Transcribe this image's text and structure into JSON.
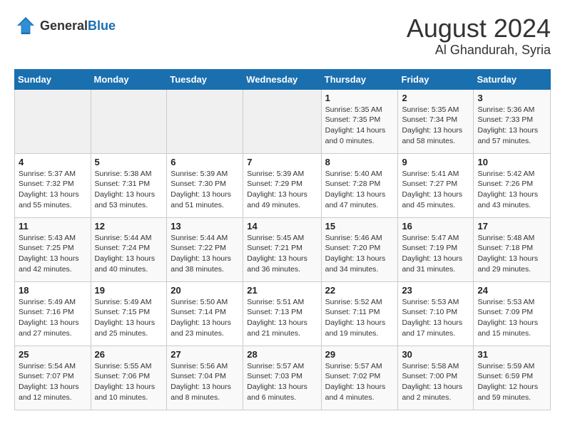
{
  "header": {
    "logo_general": "General",
    "logo_blue": "Blue",
    "title": "August 2024",
    "subtitle": "Al Ghandurah, Syria"
  },
  "calendar": {
    "days_of_week": [
      "Sunday",
      "Monday",
      "Tuesday",
      "Wednesday",
      "Thursday",
      "Friday",
      "Saturday"
    ],
    "weeks": [
      [
        {
          "day": "",
          "detail": ""
        },
        {
          "day": "",
          "detail": ""
        },
        {
          "day": "",
          "detail": ""
        },
        {
          "day": "",
          "detail": ""
        },
        {
          "day": "1",
          "detail": "Sunrise: 5:35 AM\nSunset: 7:35 PM\nDaylight: 14 hours\nand 0 minutes."
        },
        {
          "day": "2",
          "detail": "Sunrise: 5:35 AM\nSunset: 7:34 PM\nDaylight: 13 hours\nand 58 minutes."
        },
        {
          "day": "3",
          "detail": "Sunrise: 5:36 AM\nSunset: 7:33 PM\nDaylight: 13 hours\nand 57 minutes."
        }
      ],
      [
        {
          "day": "4",
          "detail": "Sunrise: 5:37 AM\nSunset: 7:32 PM\nDaylight: 13 hours\nand 55 minutes."
        },
        {
          "day": "5",
          "detail": "Sunrise: 5:38 AM\nSunset: 7:31 PM\nDaylight: 13 hours\nand 53 minutes."
        },
        {
          "day": "6",
          "detail": "Sunrise: 5:39 AM\nSunset: 7:30 PM\nDaylight: 13 hours\nand 51 minutes."
        },
        {
          "day": "7",
          "detail": "Sunrise: 5:39 AM\nSunset: 7:29 PM\nDaylight: 13 hours\nand 49 minutes."
        },
        {
          "day": "8",
          "detail": "Sunrise: 5:40 AM\nSunset: 7:28 PM\nDaylight: 13 hours\nand 47 minutes."
        },
        {
          "day": "9",
          "detail": "Sunrise: 5:41 AM\nSunset: 7:27 PM\nDaylight: 13 hours\nand 45 minutes."
        },
        {
          "day": "10",
          "detail": "Sunrise: 5:42 AM\nSunset: 7:26 PM\nDaylight: 13 hours\nand 43 minutes."
        }
      ],
      [
        {
          "day": "11",
          "detail": "Sunrise: 5:43 AM\nSunset: 7:25 PM\nDaylight: 13 hours\nand 42 minutes."
        },
        {
          "day": "12",
          "detail": "Sunrise: 5:44 AM\nSunset: 7:24 PM\nDaylight: 13 hours\nand 40 minutes."
        },
        {
          "day": "13",
          "detail": "Sunrise: 5:44 AM\nSunset: 7:22 PM\nDaylight: 13 hours\nand 38 minutes."
        },
        {
          "day": "14",
          "detail": "Sunrise: 5:45 AM\nSunset: 7:21 PM\nDaylight: 13 hours\nand 36 minutes."
        },
        {
          "day": "15",
          "detail": "Sunrise: 5:46 AM\nSunset: 7:20 PM\nDaylight: 13 hours\nand 34 minutes."
        },
        {
          "day": "16",
          "detail": "Sunrise: 5:47 AM\nSunset: 7:19 PM\nDaylight: 13 hours\nand 31 minutes."
        },
        {
          "day": "17",
          "detail": "Sunrise: 5:48 AM\nSunset: 7:18 PM\nDaylight: 13 hours\nand 29 minutes."
        }
      ],
      [
        {
          "day": "18",
          "detail": "Sunrise: 5:49 AM\nSunset: 7:16 PM\nDaylight: 13 hours\nand 27 minutes."
        },
        {
          "day": "19",
          "detail": "Sunrise: 5:49 AM\nSunset: 7:15 PM\nDaylight: 13 hours\nand 25 minutes."
        },
        {
          "day": "20",
          "detail": "Sunrise: 5:50 AM\nSunset: 7:14 PM\nDaylight: 13 hours\nand 23 minutes."
        },
        {
          "day": "21",
          "detail": "Sunrise: 5:51 AM\nSunset: 7:13 PM\nDaylight: 13 hours\nand 21 minutes."
        },
        {
          "day": "22",
          "detail": "Sunrise: 5:52 AM\nSunset: 7:11 PM\nDaylight: 13 hours\nand 19 minutes."
        },
        {
          "day": "23",
          "detail": "Sunrise: 5:53 AM\nSunset: 7:10 PM\nDaylight: 13 hours\nand 17 minutes."
        },
        {
          "day": "24",
          "detail": "Sunrise: 5:53 AM\nSunset: 7:09 PM\nDaylight: 13 hours\nand 15 minutes."
        }
      ],
      [
        {
          "day": "25",
          "detail": "Sunrise: 5:54 AM\nSunset: 7:07 PM\nDaylight: 13 hours\nand 12 minutes."
        },
        {
          "day": "26",
          "detail": "Sunrise: 5:55 AM\nSunset: 7:06 PM\nDaylight: 13 hours\nand 10 minutes."
        },
        {
          "day": "27",
          "detail": "Sunrise: 5:56 AM\nSunset: 7:04 PM\nDaylight: 13 hours\nand 8 minutes."
        },
        {
          "day": "28",
          "detail": "Sunrise: 5:57 AM\nSunset: 7:03 PM\nDaylight: 13 hours\nand 6 minutes."
        },
        {
          "day": "29",
          "detail": "Sunrise: 5:57 AM\nSunset: 7:02 PM\nDaylight: 13 hours\nand 4 minutes."
        },
        {
          "day": "30",
          "detail": "Sunrise: 5:58 AM\nSunset: 7:00 PM\nDaylight: 13 hours\nand 2 minutes."
        },
        {
          "day": "31",
          "detail": "Sunrise: 5:59 AM\nSunset: 6:59 PM\nDaylight: 12 hours\nand 59 minutes."
        }
      ]
    ]
  }
}
